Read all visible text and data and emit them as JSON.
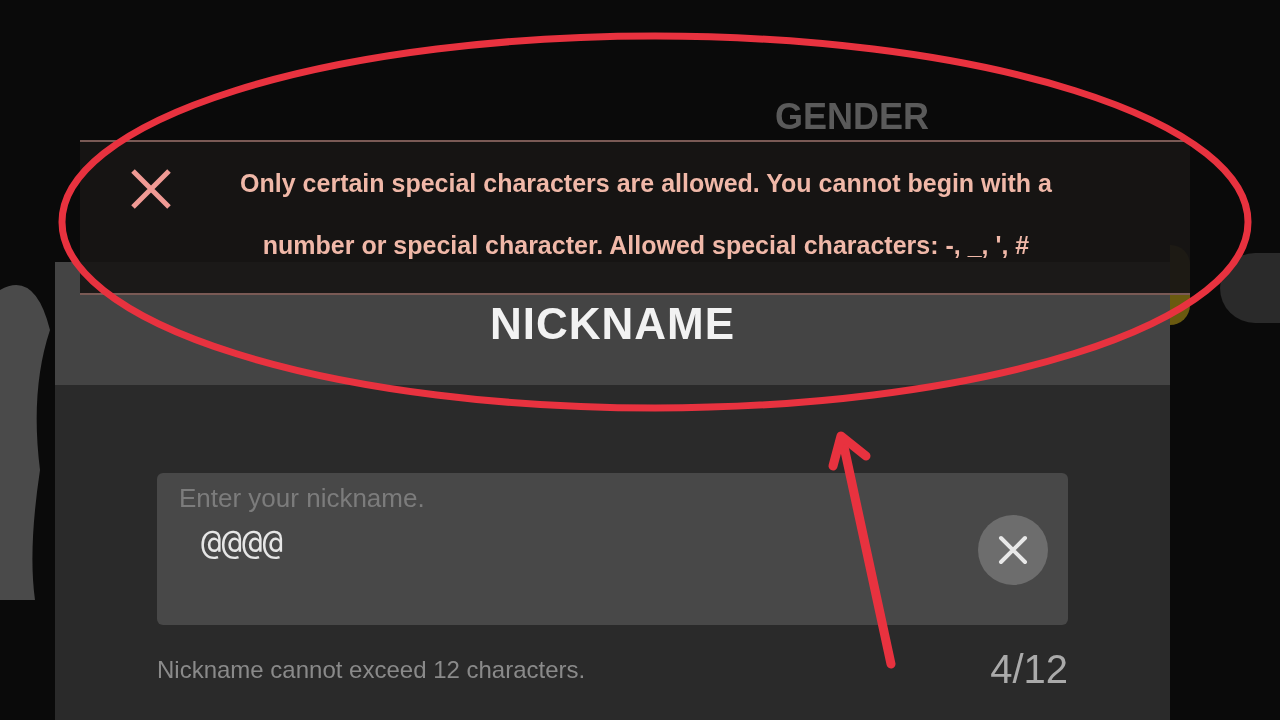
{
  "background": {
    "gender_label": "GENDER"
  },
  "toast": {
    "message": "Only certain special characters are allowed. You cannot begin with a number or special character. Allowed special characters: -, _, ', #"
  },
  "dialog": {
    "title": "NICKNAME",
    "field": {
      "label": "Enter your nickname.",
      "value": "@@@@"
    },
    "hint": "Nickname cannot exceed 12 characters.",
    "counter": "4/12"
  }
}
